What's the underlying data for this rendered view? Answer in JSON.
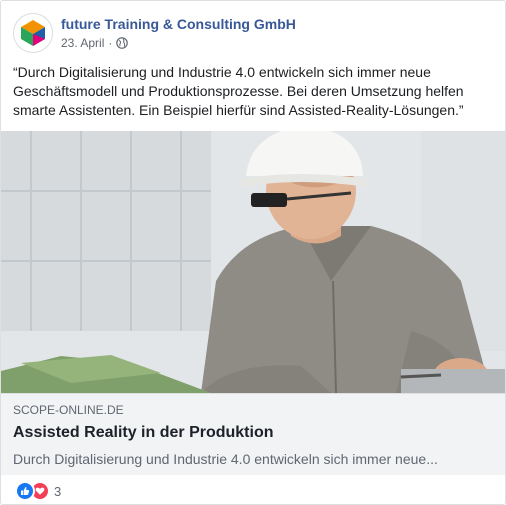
{
  "post": {
    "page_name": "future Training & Consulting GmbH",
    "date": "23. April",
    "separator": "·",
    "privacy_icon": "globe-icon",
    "text": "“Durch Digitalisierung und Industrie 4.0 entwickeln sich immer neue Geschäftsmodell und Produktionsprozesse. Bei deren Umsetzung helfen smarte Assistenten. Ein Beispiel hierfür sind Assisted-Reality-Lösungen.”"
  },
  "link": {
    "domain": "SCOPE-ONLINE.DE",
    "title": "Assisted Reality in der Produktion",
    "description": "Durch Digitalisierung und Industrie 4.0 entwickeln sich immer neue..."
  },
  "reactions": {
    "icons": [
      "like-icon",
      "love-icon"
    ],
    "count": "3"
  },
  "colors": {
    "page_name": "#385898",
    "like": "#1877f2",
    "love": "#f33e58",
    "link_bg": "#f2f3f5"
  }
}
